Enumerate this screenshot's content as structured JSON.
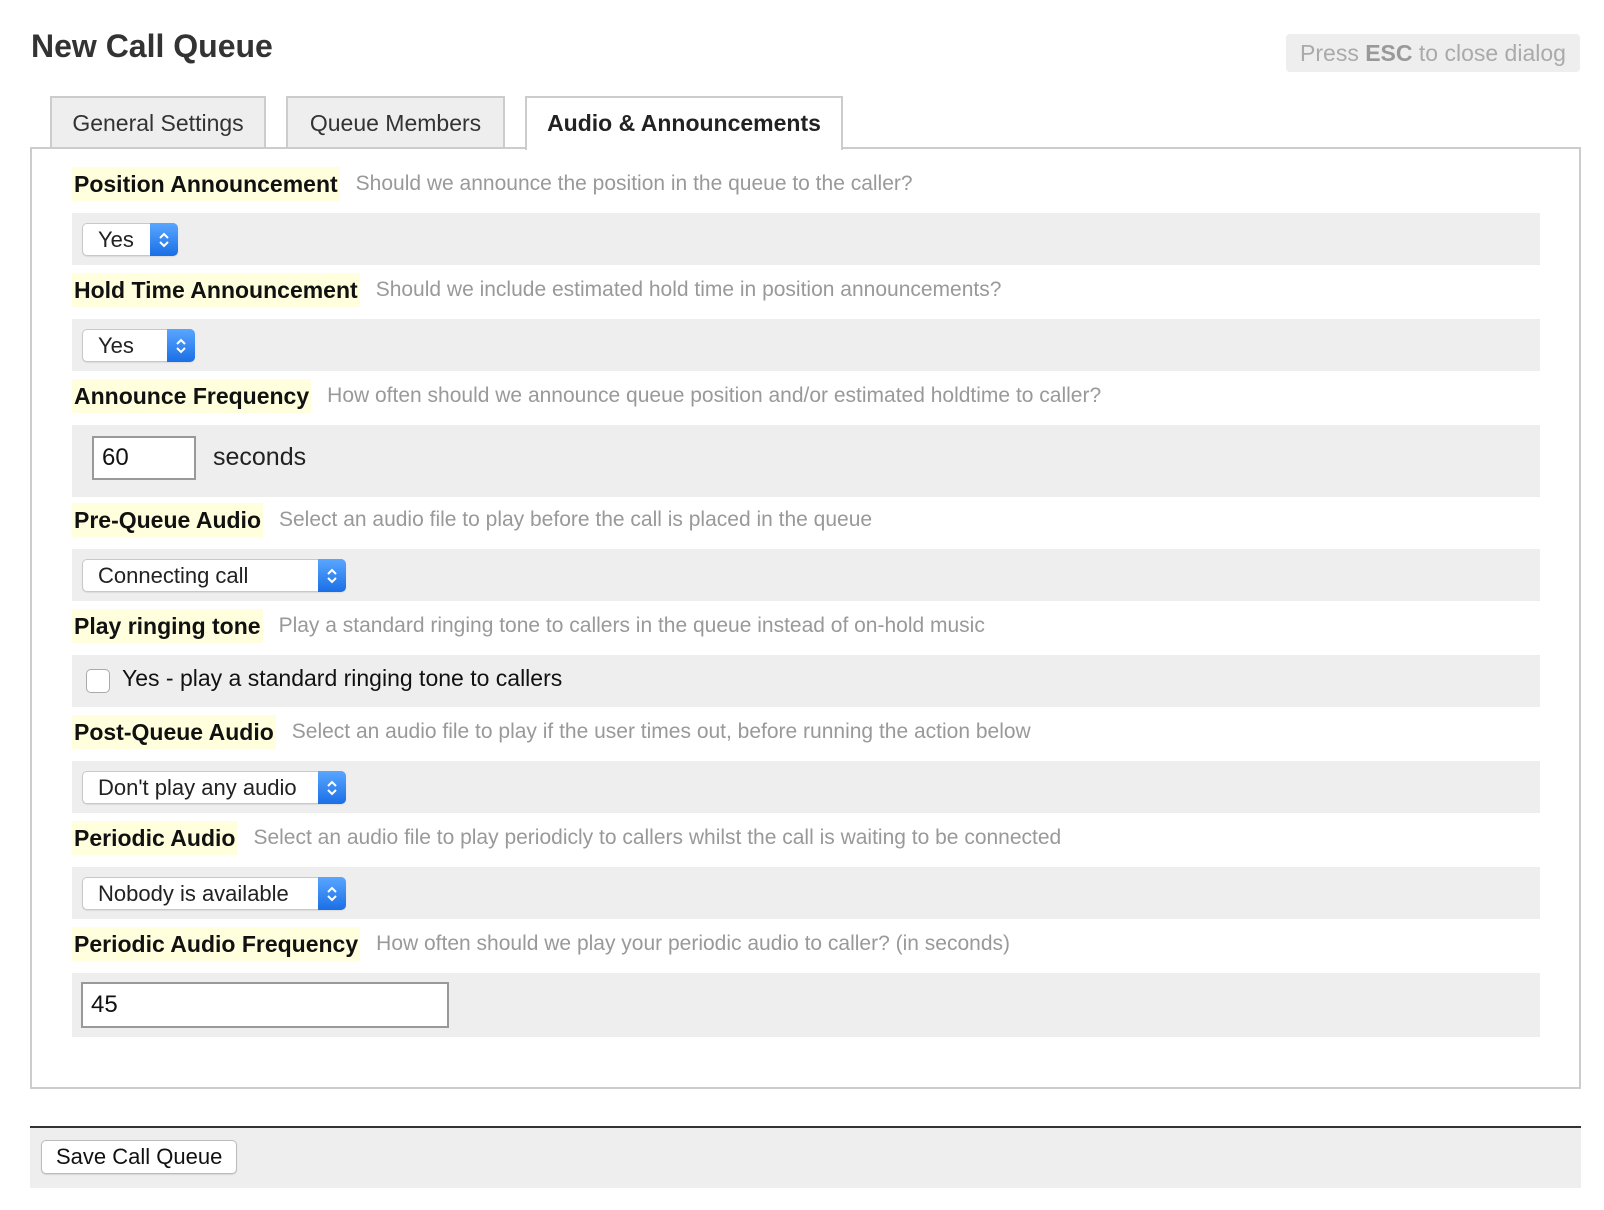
{
  "dialog": {
    "title": "New Call Queue",
    "esc_hint": {
      "prefix": "Press ",
      "key": "ESC",
      "suffix": " to close dialog"
    }
  },
  "tabs": [
    {
      "label": "General Settings",
      "active": false
    },
    {
      "label": "Queue Members",
      "active": false
    },
    {
      "label": "Audio & Announcements",
      "active": true
    }
  ],
  "fields": {
    "position_announcement": {
      "label": "Position Announcement",
      "description": "Should we announce the position in the queue to the caller?",
      "value": "Yes"
    },
    "hold_time_announcement": {
      "label": "Hold Time Announcement",
      "description": "Should we include estimated hold time in position announcements?",
      "value": "Yes"
    },
    "announce_frequency": {
      "label": "Announce Frequency",
      "description": "How often should we announce queue position and/or estimated holdtime to caller?",
      "value": "60",
      "unit": "seconds"
    },
    "pre_queue_audio": {
      "label": "Pre-Queue Audio",
      "description": "Select an audio file to play before the call is placed in the queue",
      "value": "Connecting call"
    },
    "play_ringing_tone": {
      "label": "Play ringing tone",
      "description": "Play a standard ringing tone to callers in the queue instead of on-hold music",
      "checkbox_label": "Yes - play a standard ringing tone to callers",
      "checked": false
    },
    "post_queue_audio": {
      "label": "Post-Queue Audio",
      "description": "Select an audio file to play if the user times out, before running the action below",
      "value": "Don't play any audio"
    },
    "periodic_audio": {
      "label": "Periodic Audio",
      "description": "Select an audio file to play periodicly to callers whilst the call is waiting to be connected",
      "value": "Nobody is available"
    },
    "periodic_audio_frequency": {
      "label": "Periodic Audio Frequency",
      "description": "How often should we play your periodic audio to caller? (in seconds)",
      "value": "45"
    }
  },
  "footer": {
    "save_label": "Save Call Queue"
  },
  "colors": {
    "label_highlight": "#ffffdd",
    "select_arrow": "#1a6fe6",
    "row_background": "#eeeeee"
  }
}
